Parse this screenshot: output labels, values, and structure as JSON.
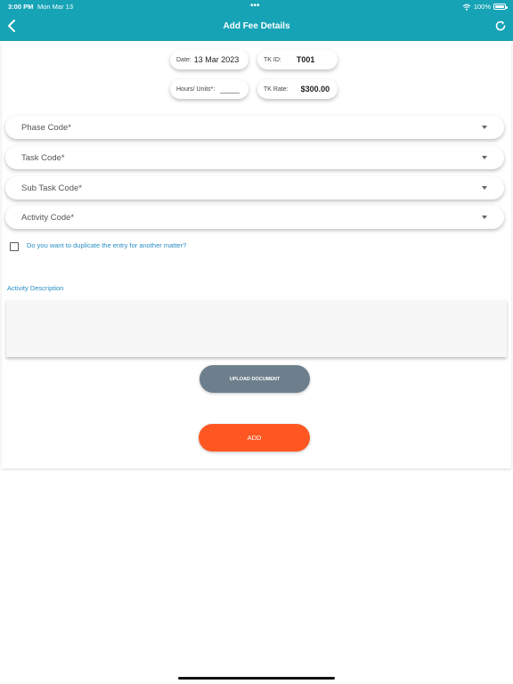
{
  "status_bar": {
    "time": "3:00 PM",
    "date": "Mon Mar 13",
    "dots": "•••",
    "battery": "100%"
  },
  "header": {
    "title": "Add Fee Details"
  },
  "icons": {
    "back": "chevron-left-icon",
    "refresh": "refresh-icon",
    "wifi": "wifi-icon",
    "battery": "battery-icon",
    "dropdown": "caret-down-icon"
  },
  "colors": {
    "header": "#16a3b6",
    "link": "#2a8ec3",
    "upload_button": "#6d7f8c",
    "add_button": "#ff5722"
  },
  "fields": {
    "date_label": "Date:",
    "date_value": "13 Mar 2023",
    "tk_id_label": "TK ID:",
    "tk_id_value": "T001",
    "hours_label": "Hours/ Units*:",
    "hours_value": "",
    "tk_rate_label": "TK Rate:",
    "tk_rate_value": "$300.00"
  },
  "dropdowns": {
    "phase": "Phase Code*",
    "task": "Task Code*",
    "sub_task": "Sub Task Code*",
    "activity": "Activity Code*"
  },
  "duplicate": {
    "label": "Do you want to duplicate the entry for another matter?",
    "checked": false
  },
  "description": {
    "label": "Activity Description",
    "value": ""
  },
  "buttons": {
    "upload": "UPLOAD DOCUMENT",
    "add": "ADD"
  }
}
